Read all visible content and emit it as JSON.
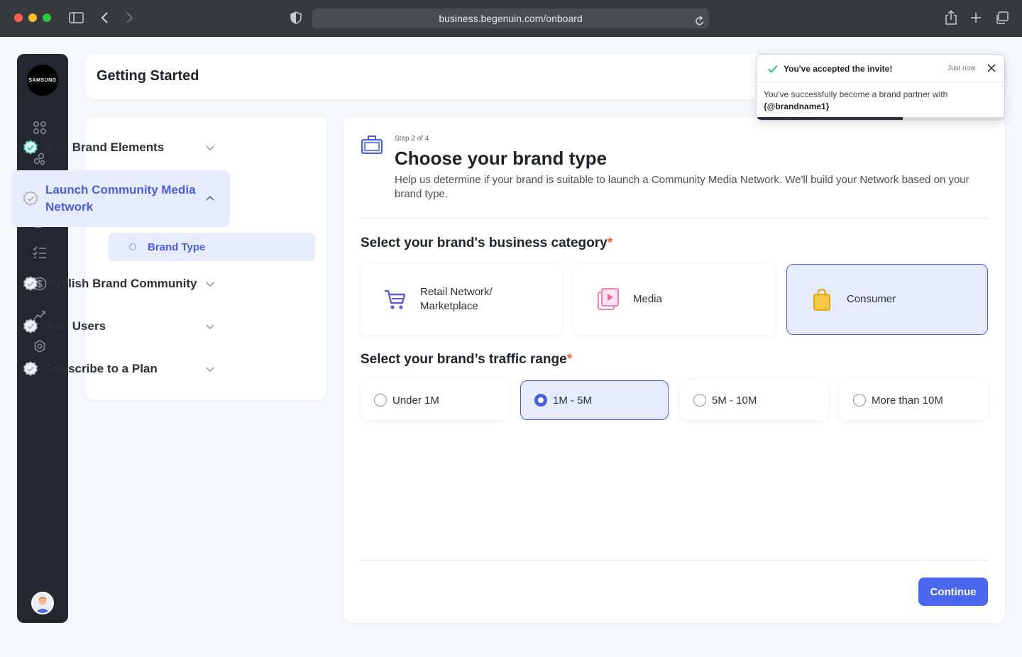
{
  "browser": {
    "url": "business.begenuin.com/onboard"
  },
  "rail": {
    "logo_text": "SAMSUNG",
    "items": [
      "grid-icon",
      "community-icon",
      "magic-wand-icon",
      "video-file-icon",
      "checklist-icon",
      "dollar-icon",
      "analytics-icon",
      "settings-icon"
    ]
  },
  "header": {
    "title": "Getting Started"
  },
  "steps_panel": {
    "items": [
      {
        "label": "Add Brand Elements",
        "status": "complete"
      },
      {
        "label": "Launch Community Media Network",
        "status": "active"
      },
      {
        "label": "Publish Brand Community",
        "status": "pending"
      },
      {
        "label": "Add Users",
        "status": "pending"
      },
      {
        "label": "Subscribe to a Plan",
        "status": "pending"
      }
    ],
    "sub_item": "Brand Type"
  },
  "main": {
    "step_text": "Step 2 of 4",
    "title": "Choose your brand type",
    "description": "Help us determine if your brand is suitable to launch a Community Media Network. We'll build your Network based on your brand type.",
    "category_heading": "Select your brand's business category",
    "categories": [
      {
        "label": "Retail Network/\nMarketplace",
        "selected": false
      },
      {
        "label": "Media",
        "selected": false
      },
      {
        "label": "Consumer",
        "selected": true
      }
    ],
    "traffic_heading": "Select your brand’s traffic range",
    "required_mark": "*",
    "traffic": [
      {
        "label": "Under 1M",
        "selected": false
      },
      {
        "label": "1M - 5M",
        "selected": true
      },
      {
        "label": "5M - 10M",
        "selected": false
      },
      {
        "label": "More than 10M",
        "selected": false
      }
    ],
    "continue_label": "Continue"
  },
  "toast": {
    "title": "You've accepted the invite!",
    "time": "Just now",
    "message": "You've successfully become a brand partner with",
    "handle": "{@brandname1}",
    "progress": 0.59
  },
  "colors": {
    "accent": "#4a67ee",
    "active_bg": "#e6ecfd",
    "rail_bg": "#24272f",
    "required": "#e8693e"
  }
}
